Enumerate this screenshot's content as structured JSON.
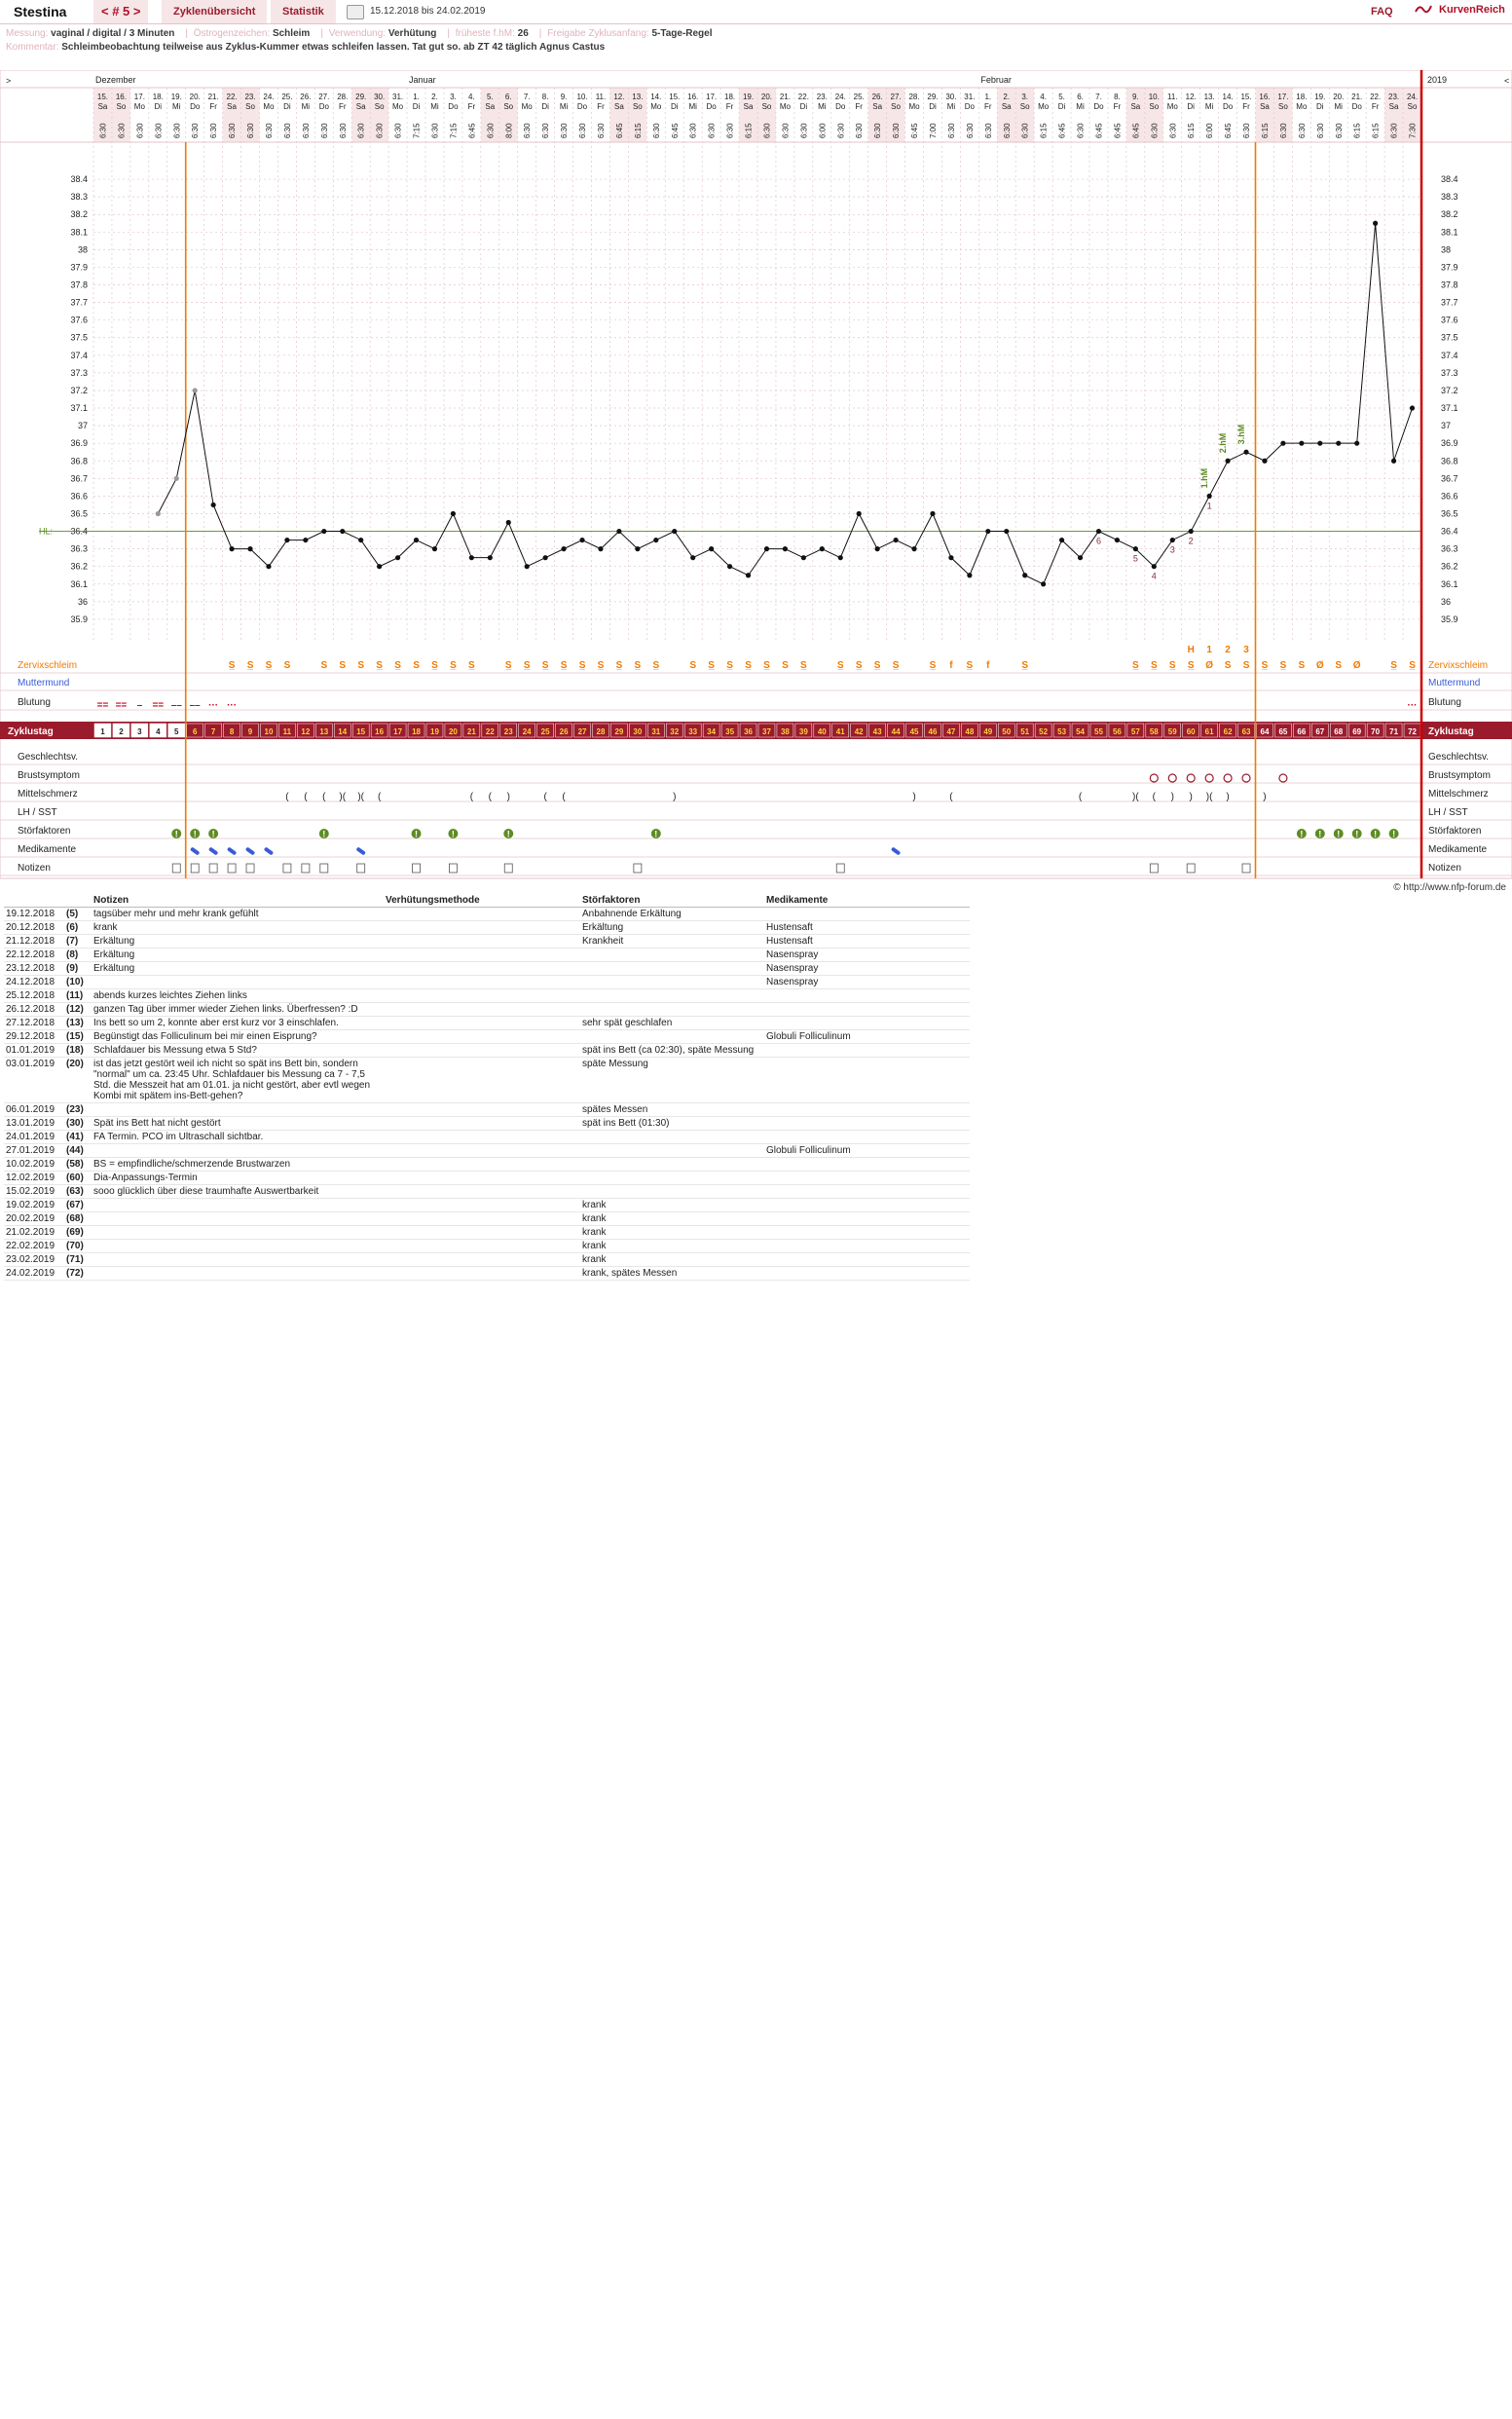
{
  "header": {
    "user": "Stestina",
    "cycle_nav": "< # 5 >",
    "tab_cycles": "Zyklenübersicht",
    "tab_stats": "Statistik",
    "date_range": "15.12.2018 bis 24.02.2019",
    "faq": "FAQ",
    "brand": "KurvenReich"
  },
  "meta": {
    "measurement_label": "Messung:",
    "measurement": "vaginal / digital / 3 Minuten",
    "estrogen_label": "Östrogenzeichen:",
    "estrogen": "Schleim",
    "use_label": "Verwendung:",
    "use": "Verhütung",
    "earliest_label": "früheste f.hM:",
    "earliest": "26",
    "release_label": "Freigabe Zyklusanfang:",
    "release": "5-Tage-Regel",
    "comment_label": "Kommentar:",
    "comment": "Schleimbeobachtung teilweise aus Zyklus-Kummer etwas schleifen lassen. Tat gut so. ab ZT 42 täglich Agnus Castus",
    "copyright": "© http://www.nfp-forum.de"
  },
  "chart_data": {
    "type": "line",
    "title": "",
    "x": [
      1,
      2,
      3,
      4,
      5,
      6,
      7,
      8,
      9,
      10,
      11,
      12,
      13,
      14,
      15,
      16,
      17,
      18,
      19,
      20,
      21,
      22,
      23,
      24,
      25,
      26,
      27,
      28,
      29,
      30,
      31,
      32,
      33,
      34,
      35,
      36,
      37,
      38,
      39,
      40,
      41,
      42,
      43,
      44,
      45,
      46,
      47,
      48,
      49,
      50,
      51,
      52,
      53,
      54,
      55,
      56,
      57,
      58,
      59,
      60,
      61,
      62,
      63,
      64,
      65,
      66,
      67,
      68,
      69,
      70,
      71,
      72
    ],
    "months": [
      {
        "label": "Dezember",
        "start": 1
      },
      {
        "label": "Januar",
        "start": 18
      },
      {
        "label": "Februar",
        "start": 49
      }
    ],
    "year_label": "2019",
    "dates": [
      "15.",
      "16.",
      "17.",
      "18.",
      "19.",
      "20.",
      "21.",
      "22.",
      "23.",
      "24.",
      "25.",
      "26.",
      "27.",
      "28.",
      "29.",
      "30.",
      "31.",
      "1.",
      "2.",
      "3.",
      "4.",
      "5.",
      "6.",
      "7.",
      "8.",
      "9.",
      "10.",
      "11.",
      "12.",
      "13.",
      "14.",
      "15.",
      "16.",
      "17.",
      "18.",
      "19.",
      "20.",
      "21.",
      "22.",
      "23.",
      "24.",
      "25.",
      "26.",
      "27.",
      "28.",
      "29.",
      "30.",
      "31.",
      "1.",
      "2.",
      "3.",
      "4.",
      "5.",
      "6.",
      "7.",
      "8.",
      "9.",
      "10.",
      "11.",
      "12.",
      "13.",
      "14.",
      "15.",
      "16.",
      "17.",
      "18.",
      "19.",
      "20.",
      "21.",
      "22.",
      "23.",
      "24."
    ],
    "weekdays": [
      "Sa",
      "So",
      "Mo",
      "Di",
      "Mi",
      "Do",
      "Fr",
      "Sa",
      "So",
      "Mo",
      "Di",
      "Mi",
      "Do",
      "Fr",
      "Sa",
      "So",
      "Mo",
      "Di",
      "Mi",
      "Do",
      "Fr",
      "Sa",
      "So",
      "Mo",
      "Di",
      "Mi",
      "Do",
      "Fr",
      "Sa",
      "So",
      "Mo",
      "Di",
      "Mi",
      "Do",
      "Fr",
      "Sa",
      "So",
      "Mo",
      "Di",
      "Mi",
      "Do",
      "Fr",
      "Sa",
      "So",
      "Mo",
      "Di",
      "Mi",
      "Do",
      "Fr",
      "Sa",
      "So",
      "Mo",
      "Di",
      "Mi",
      "Do",
      "Fr",
      "Sa",
      "So",
      "Mo",
      "Di",
      "Mi",
      "Do",
      "Fr",
      "Sa",
      "So",
      "Mo",
      "Di",
      "Mi",
      "Do",
      "Fr",
      "Sa",
      "So"
    ],
    "times": [
      "6:30",
      "6:30",
      "6:30",
      "6:30",
      "6:30",
      "6:30",
      "6:30",
      "6:30",
      "6:30",
      "6:30",
      "6:30",
      "6:30",
      "6:30",
      "6:30",
      "6:30",
      "6:30",
      "6:30",
      "7:15",
      "6:30",
      "7:15",
      "6:45",
      "6:30",
      "8:00",
      "6:30",
      "6:30",
      "6:30",
      "6:30",
      "6:30",
      "6:45",
      "6:15",
      "6:30",
      "6:45",
      "6:30",
      "6:30",
      "6:30",
      "6:15",
      "6:30",
      "6:30",
      "6:30",
      "6:00",
      "6:30",
      "6:30",
      "6:30",
      "6:30",
      "6:45",
      "7:00",
      "6:30",
      "6:30",
      "6:30",
      "6:30",
      "6:30",
      "6:15",
      "6:45",
      "6:30",
      "6:45",
      "6:45",
      "6:45",
      "6:30",
      "6:30",
      "6:15",
      "6:00",
      "6:45",
      "6:30",
      "6:15",
      "6:30",
      "6:30",
      "6:30",
      "6:30",
      "6:15",
      "6:15",
      "6:30",
      "7:30"
    ],
    "cycle_days": [
      1,
      2,
      3,
      4,
      5,
      6,
      7,
      8,
      9,
      10,
      11,
      12,
      13,
      14,
      15,
      16,
      17,
      18,
      19,
      20,
      21,
      22,
      23,
      24,
      25,
      26,
      27,
      28,
      29,
      30,
      31,
      32,
      33,
      34,
      35,
      36,
      37,
      38,
      39,
      40,
      41,
      42,
      43,
      44,
      45,
      46,
      47,
      48,
      49,
      50,
      51,
      52,
      53,
      54,
      55,
      56,
      57,
      58,
      59,
      60,
      61,
      62,
      63,
      64,
      65,
      66,
      67,
      68,
      69,
      70,
      71,
      72
    ],
    "temperatures": [
      null,
      null,
      null,
      36.5,
      36.7,
      37.2,
      36.55,
      36.3,
      36.3,
      36.2,
      36.35,
      36.35,
      36.4,
      36.4,
      36.35,
      36.2,
      36.25,
      36.35,
      36.3,
      36.5,
      36.25,
      36.25,
      36.45,
      36.2,
      36.25,
      36.3,
      36.35,
      36.3,
      36.4,
      36.3,
      36.35,
      36.4,
      36.25,
      36.3,
      36.2,
      36.15,
      36.3,
      36.3,
      36.25,
      36.3,
      36.25,
      36.5,
      36.3,
      36.35,
      36.3,
      36.5,
      36.25,
      36.15,
      36.4,
      36.4,
      36.15,
      36.1,
      36.35,
      36.25,
      36.4,
      36.35,
      36.3,
      36.2,
      36.35,
      36.4,
      36.6,
      36.8,
      36.85,
      36.8,
      36.9,
      36.9,
      36.9,
      36.9,
      36.9,
      38.15,
      36.8,
      37.1
    ],
    "ylim": [
      35.8,
      38.5
    ],
    "y_ticks": [
      35.9,
      36,
      36.1,
      36.2,
      36.3,
      36.4,
      36.5,
      36.6,
      36.7,
      36.8,
      36.9,
      37,
      37.1,
      37.2,
      37.3,
      37.4,
      37.5,
      37.6,
      37.7,
      37.8,
      37.9,
      38,
      38.1,
      38.2,
      38.3,
      38.4
    ],
    "hl_label": "HL:",
    "hl": 36.4,
    "low_marks": [
      {
        "day": 55,
        "n": "6"
      },
      {
        "day": 57,
        "n": "5"
      },
      {
        "day": 58,
        "n": "4"
      },
      {
        "day": 59,
        "n": "3"
      },
      {
        "day": 60,
        "n": "2"
      },
      {
        "day": 61,
        "n": "1"
      }
    ],
    "high_marks": [
      {
        "day": 61,
        "n": "1.hM"
      },
      {
        "day": 62,
        "n": "2.hM"
      },
      {
        "day": 63,
        "n": "3.hM"
      }
    ],
    "mucus_counter": [
      {
        "day": 60,
        "n": "H"
      },
      {
        "day": 61,
        "n": "1"
      },
      {
        "day": 62,
        "n": "2"
      },
      {
        "day": 63,
        "n": "3"
      }
    ],
    "vertical_lines": [
      5,
      63
    ],
    "rows": {
      "zervix": "Zervixschleim",
      "mumu": "Muttermund",
      "blut": "Blutung",
      "zyklus": "Zyklustag",
      "gv": "Geschlechtsv.",
      "brust": "Brustsymptom",
      "mittel": "Mittelschmerz",
      "lh": "LH / SST",
      "stoer": "Störfaktoren",
      "medi": "Medikamente",
      "notiz": "Notizen"
    },
    "mucus": {
      "8": "S̲",
      "9": "S̲",
      "10": "S̲",
      "11": "S",
      "13": "S",
      "14": "S",
      "15": "S",
      "16": "S̲",
      "17": "S̲",
      "18": "S",
      "19": "S̲",
      "20": "S̲",
      "21": "S̲",
      "23": "S̲",
      "24": "S̲",
      "25": "S̲",
      "26": "S̲",
      "27": "S̲",
      "28": "S̲",
      "29": "S̲",
      "30": "S̲",
      "31": "S̲",
      "33": "S",
      "34": "S̲",
      "35": "S̲",
      "36": "S̲",
      "37": "S̲",
      "38": "S",
      "39": "S̲",
      "41": "S̲",
      "42": "S̲",
      "43": "S̲",
      "44": "S̲",
      "46": "S̲",
      "47": "f",
      "48": "S̲",
      "49": "f",
      "51": "S̲",
      "57": "S̲",
      "58": "S̲",
      "59": "S̲",
      "60": "S̲",
      "61": "Ø",
      "62": "S",
      "63": "S",
      "64": "S̲",
      "65": "S̲",
      "66": "S",
      "67": "Ø",
      "68": "S",
      "69": "Ø",
      "71": "S̲",
      "72": "S̲"
    },
    "bleeding": {
      "1": "==",
      "2": "==",
      "3": "–",
      "4": "==",
      "5": "––",
      "6": "––",
      "7": "···",
      "8": "···",
      "72": "···"
    },
    "pain": {
      "11": "(",
      "12": "(",
      "13": "(",
      "14": ")(",
      "15": ")(",
      "16": "(",
      "21": "(",
      "22": "(",
      "23": ")",
      "25": "(",
      "26": "(",
      "32": ")",
      "45": ")",
      "47": "(",
      "54": "(",
      "57": ")(",
      "58": "(",
      "59": ")",
      "60": ")",
      "61": ")(",
      "62": ")",
      "64": ")"
    },
    "breast": [
      58,
      59,
      60,
      61,
      62,
      63,
      65
    ],
    "disturb": [
      5,
      6,
      7,
      13,
      18,
      20,
      23,
      31,
      66,
      67,
      68,
      69,
      70,
      71
    ],
    "meds": [
      6,
      7,
      8,
      9,
      10,
      15,
      44
    ],
    "notes_days": [
      5,
      6,
      7,
      8,
      9,
      11,
      12,
      13,
      15,
      18,
      20,
      23,
      30,
      41,
      58,
      60,
      63
    ]
  },
  "notes_table": {
    "headers": [
      "Notizen",
      "Verhütungsmethode",
      "Störfaktoren",
      "Medikamente"
    ],
    "rows": [
      {
        "date": "19.12.2018",
        "ct": "(5)",
        "note": "tagsüber mehr und mehr krank gefühlt",
        "meth": "",
        "stoer": "Anbahnende Erkältung",
        "med": ""
      },
      {
        "date": "20.12.2018",
        "ct": "(6)",
        "note": "krank",
        "meth": "",
        "stoer": "Erkältung",
        "med": "Hustensaft"
      },
      {
        "date": "21.12.2018",
        "ct": "(7)",
        "note": "Erkältung",
        "meth": "",
        "stoer": "Krankheit",
        "med": "Hustensaft"
      },
      {
        "date": "22.12.2018",
        "ct": "(8)",
        "note": "Erkältung",
        "meth": "",
        "stoer": "",
        "med": "Nasenspray"
      },
      {
        "date": "23.12.2018",
        "ct": "(9)",
        "note": "Erkältung",
        "meth": "",
        "stoer": "",
        "med": "Nasenspray"
      },
      {
        "date": "24.12.2018",
        "ct": "(10)",
        "note": "",
        "meth": "",
        "stoer": "",
        "med": "Nasenspray"
      },
      {
        "date": "25.12.2018",
        "ct": "(11)",
        "note": "abends kurzes leichtes Ziehen links",
        "meth": "",
        "stoer": "",
        "med": ""
      },
      {
        "date": "26.12.2018",
        "ct": "(12)",
        "note": "ganzen Tag über immer wieder Ziehen links. Überfressen? :D",
        "meth": "",
        "stoer": "",
        "med": ""
      },
      {
        "date": "27.12.2018",
        "ct": "(13)",
        "note": "Ins bett so um 2, konnte aber erst kurz vor 3 einschlafen.",
        "meth": "",
        "stoer": "sehr spät geschlafen",
        "med": ""
      },
      {
        "date": "29.12.2018",
        "ct": "(15)",
        "note": "Begünstigt das Folliculinum bei mir einen Eisprung?",
        "meth": "",
        "stoer": "",
        "med": "Globuli Folliculinum"
      },
      {
        "date": "01.01.2019",
        "ct": "(18)",
        "note": "Schlafdauer bis Messung etwa 5 Std?",
        "meth": "",
        "stoer": "spät ins Bett (ca 02:30), späte Messung",
        "med": ""
      },
      {
        "date": "03.01.2019",
        "ct": "(20)",
        "note": "ist das jetzt gestört weil ich nicht so spät ins Bett bin, sondern \"normal\" um ca. 23:45 Uhr. Schlafdauer bis Messung ca 7 - 7,5 Std. die Messzeit hat am 01.01. ja nicht gestört, aber evtl wegen Kombi mit spätem ins-Bett-gehen?",
        "meth": "",
        "stoer": "späte Messung",
        "med": ""
      },
      {
        "date": "06.01.2019",
        "ct": "(23)",
        "note": "",
        "meth": "",
        "stoer": "spätes Messen",
        "med": ""
      },
      {
        "date": "13.01.2019",
        "ct": "(30)",
        "note": "Spät ins Bett hat nicht gestört",
        "meth": "",
        "stoer": "spät ins Bett (01:30)",
        "med": ""
      },
      {
        "date": "24.01.2019",
        "ct": "(41)",
        "note": "FA Termin. PCO im Ultraschall sichtbar.",
        "meth": "",
        "stoer": "",
        "med": ""
      },
      {
        "date": "27.01.2019",
        "ct": "(44)",
        "note": "",
        "meth": "",
        "stoer": "",
        "med": "Globuli Folliculinum"
      },
      {
        "date": "10.02.2019",
        "ct": "(58)",
        "note": "BS = empfindliche/schmerzende Brustwarzen",
        "meth": "",
        "stoer": "",
        "med": ""
      },
      {
        "date": "12.02.2019",
        "ct": "(60)",
        "note": "Dia-Anpassungs-Termin",
        "meth": "",
        "stoer": "",
        "med": ""
      },
      {
        "date": "15.02.2019",
        "ct": "(63)",
        "note": "sooo glücklich über diese traumhafte Auswertbarkeit",
        "meth": "",
        "stoer": "",
        "med": ""
      },
      {
        "date": "19.02.2019",
        "ct": "(67)",
        "note": "",
        "meth": "",
        "stoer": "krank",
        "med": ""
      },
      {
        "date": "20.02.2019",
        "ct": "(68)",
        "note": "",
        "meth": "",
        "stoer": "krank",
        "med": ""
      },
      {
        "date": "21.02.2019",
        "ct": "(69)",
        "note": "",
        "meth": "",
        "stoer": "krank",
        "med": ""
      },
      {
        "date": "22.02.2019",
        "ct": "(70)",
        "note": "",
        "meth": "",
        "stoer": "krank",
        "med": ""
      },
      {
        "date": "23.02.2019",
        "ct": "(71)",
        "note": "",
        "meth": "",
        "stoer": "krank",
        "med": ""
      },
      {
        "date": "24.02.2019",
        "ct": "(72)",
        "note": "",
        "meth": "",
        "stoer": "krank, spätes Messen",
        "med": ""
      }
    ]
  },
  "colors": {
    "brand": "#9a1b2c",
    "orange": "#f07a00",
    "red_line": "#cc0000",
    "grid": "#e3c5ca",
    "green": "#5e8c24",
    "blue": "#3a5bd8",
    "weekend": "#f6e6e8"
  }
}
